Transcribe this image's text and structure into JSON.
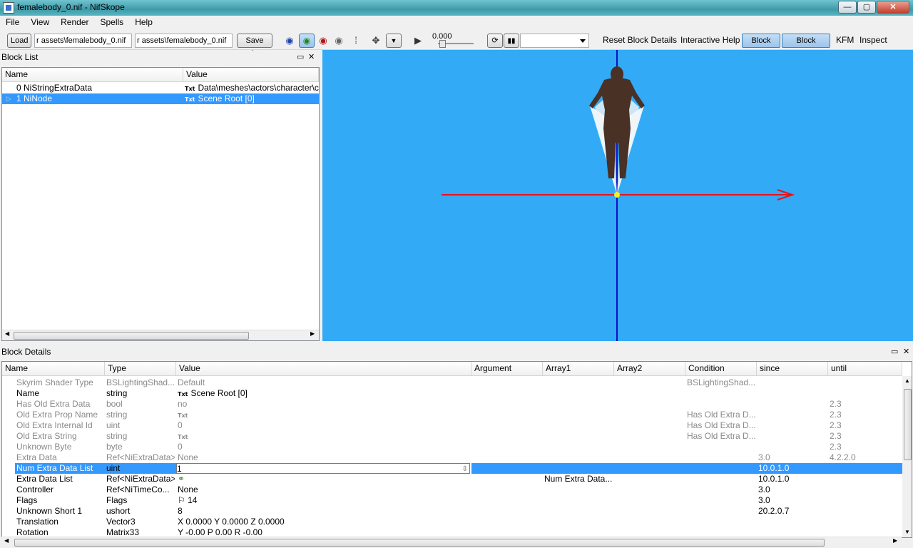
{
  "window": {
    "title": "femalebody_0.nif - NifSkope",
    "min": "—",
    "max": "▢",
    "close": "✕"
  },
  "menu": [
    "File",
    "View",
    "Render",
    "Spells",
    "Help"
  ],
  "toolbar": {
    "load": "Load",
    "path1": "r assets\\femalebody_0.nif",
    "path2": "r assets\\femalebody_0.nif",
    "save_as": "Save As",
    "time_value": "0.000",
    "reset_block_details": "Reset Block Details",
    "interactive_help": "Interactive Help",
    "block_list": "Block List",
    "block_details": "Block Details",
    "kfm": "KFM",
    "inspect": "Inspect"
  },
  "block_list": {
    "title": "Block List",
    "col_name": "Name",
    "col_value": "Value",
    "rows": [
      {
        "name": "0 NiStringExtraData",
        "value": "Data\\meshes\\actors\\character\\c"
      },
      {
        "name": "1 NiNode",
        "value": "Scene Root [0]"
      }
    ],
    "txt_tag": "Txt"
  },
  "block_details": {
    "title": "Block Details",
    "columns": [
      "Name",
      "Type",
      "Value",
      "Argument",
      "Array1",
      "Array2",
      "Condition",
      "since",
      "until"
    ],
    "rows": [
      {
        "name": "Skyrim Shader Type",
        "type": "BSLightingShad...",
        "value": "Default",
        "arg": "",
        "a1": "",
        "a2": "",
        "cond": "BSLightingShad...",
        "since": "",
        "until": "",
        "dim": true
      },
      {
        "name": "Name",
        "type": "string",
        "value": "Scene Root [0]",
        "txt": true,
        "arg": "",
        "a1": "",
        "a2": "",
        "cond": "",
        "since": "",
        "until": "",
        "dim": false
      },
      {
        "name": "Has Old Extra Data",
        "type": "bool",
        "value": "no",
        "arg": "",
        "a1": "",
        "a2": "",
        "cond": "",
        "since": "",
        "until": "2.3",
        "dim": true
      },
      {
        "name": "Old Extra Prop Name",
        "type": "string",
        "value": "",
        "txt": true,
        "arg": "",
        "a1": "",
        "a2": "",
        "cond": "Has Old Extra D...",
        "since": "",
        "until": "2.3",
        "dim": true
      },
      {
        "name": "Old Extra Internal Id",
        "type": "uint",
        "value": "0",
        "arg": "",
        "a1": "",
        "a2": "",
        "cond": "Has Old Extra D...",
        "since": "",
        "until": "2.3",
        "dim": true
      },
      {
        "name": "Old Extra String",
        "type": "string",
        "value": "",
        "txt": true,
        "arg": "",
        "a1": "",
        "a2": "",
        "cond": "Has Old Extra D...",
        "since": "",
        "until": "2.3",
        "dim": true
      },
      {
        "name": "Unknown Byte",
        "type": "byte",
        "value": "0",
        "arg": "",
        "a1": "",
        "a2": "",
        "cond": "",
        "since": "",
        "until": "2.3",
        "dim": true
      },
      {
        "name": "Extra Data",
        "type": "Ref<NiExtraData>",
        "value": "None",
        "arg": "",
        "a1": "",
        "a2": "",
        "cond": "",
        "since": "3.0",
        "until": "4.2.2.0",
        "dim": true
      },
      {
        "name": "Num Extra Data List",
        "type": "uint",
        "value": "1",
        "arg": "",
        "a1": "",
        "a2": "",
        "cond": "",
        "since": "10.0.1.0",
        "until": "",
        "dim": false,
        "sel": true
      },
      {
        "name": "Extra Data List",
        "type": "Ref<NiExtraData>",
        "value": "",
        "link": true,
        "arg": "",
        "a1": "Num Extra Data...",
        "a2": "",
        "cond": "",
        "since": "10.0.1.0",
        "until": "",
        "dim": false
      },
      {
        "name": "Controller",
        "type": "Ref<NiTimeCo...",
        "value": "None",
        "arg": "",
        "a1": "",
        "a2": "",
        "cond": "",
        "since": "3.0",
        "until": "",
        "dim": false
      },
      {
        "name": "Flags",
        "type": "Flags",
        "value": "14",
        "flag": true,
        "arg": "",
        "a1": "",
        "a2": "",
        "cond": "",
        "since": "3.0",
        "until": "",
        "dim": false
      },
      {
        "name": "Unknown Short 1",
        "type": "ushort",
        "value": "8",
        "arg": "",
        "a1": "",
        "a2": "",
        "cond": "",
        "since": "20.2.0.7",
        "until": "",
        "dim": false
      },
      {
        "name": "Translation",
        "type": "Vector3",
        "value": "X 0.0000 Y 0.0000 Z 0.0000",
        "arg": "",
        "a1": "",
        "a2": "",
        "cond": "",
        "since": "",
        "until": "",
        "dim": false
      },
      {
        "name": "Rotation",
        "type": "Matrix33",
        "value": "Y -0.00 P 0.00 R -0.00",
        "arg": "",
        "a1": "",
        "a2": "",
        "cond": "",
        "since": "",
        "until": "",
        "dim": false
      }
    ]
  },
  "colors": {
    "viewport_bg": "#32aaf5",
    "selection": "#3399ff",
    "axis_x": "#e8111e",
    "axis_z": "#1010c8",
    "origin": "#f0f020"
  },
  "icons": [
    "app-icon",
    "eye-blue-icon",
    "eye-green-icon",
    "eye-red-icon",
    "eye-gray-icon",
    "footprints-icon",
    "move-icon",
    "dropdown-icon",
    "play-icon",
    "loop-icon",
    "step-icon",
    "link-icon",
    "flag-icon"
  ]
}
